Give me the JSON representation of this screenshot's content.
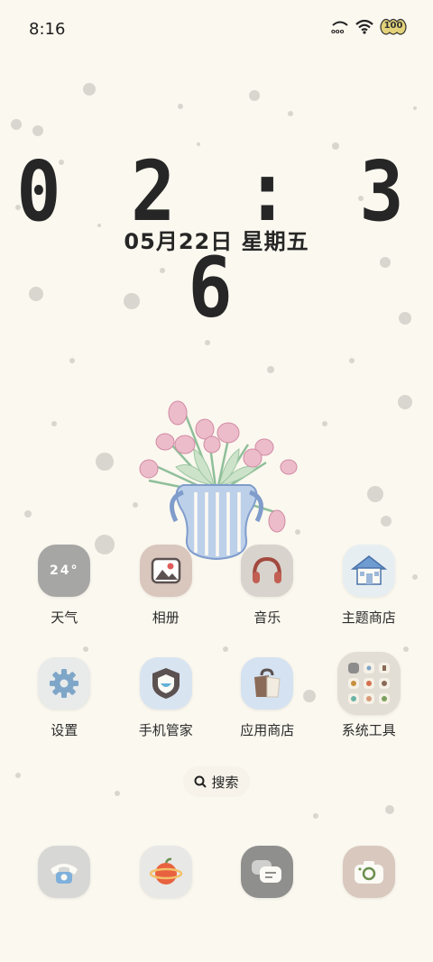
{
  "status_bar": {
    "time": "8:16",
    "battery_level": "100",
    "icons": [
      "hd-signal-icon",
      "wifi-icon",
      "battery-icon"
    ]
  },
  "clock": {
    "time": "0 2 : 3 6",
    "date": "05月22日 星期五"
  },
  "apps": [
    {
      "label": "天气",
      "icon": "weather-icon",
      "icon_text": "24°"
    },
    {
      "label": "相册",
      "icon": "gallery-icon"
    },
    {
      "label": "音乐",
      "icon": "music-icon"
    },
    {
      "label": "主题商店",
      "icon": "theme-store-icon"
    },
    {
      "label": "设置",
      "icon": "settings-icon"
    },
    {
      "label": "手机管家",
      "icon": "phone-manager-icon"
    },
    {
      "label": "应用商店",
      "icon": "app-store-icon"
    },
    {
      "label": "系统工具",
      "icon": "system-tools-folder-icon"
    }
  ],
  "search": {
    "label": "搜索"
  },
  "dock": [
    {
      "icon": "phone-icon"
    },
    {
      "icon": "browser-icon"
    },
    {
      "icon": "messages-icon"
    },
    {
      "icon": "camera-icon"
    }
  ],
  "colors": {
    "background": "#fbf8ef",
    "text": "#262626",
    "tulip_pink": "#e9b4c4",
    "vase_blue": "#a9c1de"
  }
}
